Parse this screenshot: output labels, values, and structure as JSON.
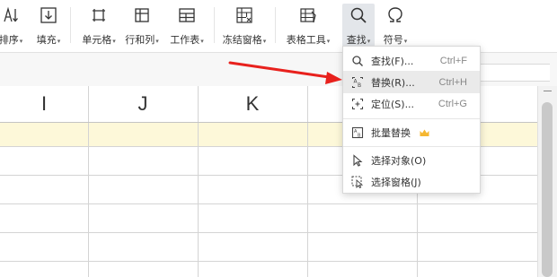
{
  "ribbon": {
    "sort_label": "排序",
    "fill_label": "填充",
    "cell_label": "单元格",
    "rowcol_label": "行和列",
    "worksheet_label": "工作表",
    "freeze_label": "冻结窗格",
    "tabletools_label": "表格工具",
    "find_label": "查找",
    "symbol_label": "符号",
    "caret": "▾"
  },
  "sheet": {
    "columns": [
      "I",
      "J",
      "K"
    ],
    "highlight_color": "#fdf8d9"
  },
  "find_menu": {
    "items": [
      {
        "label": "查找(F)...",
        "shortcut": "Ctrl+F",
        "icon": "search-icon"
      },
      {
        "label": "替换(R)...",
        "shortcut": "Ctrl+H",
        "icon": "replace-icon"
      },
      {
        "label": "定位(S)...",
        "shortcut": "Ctrl+G",
        "icon": "locate-icon"
      },
      {
        "label": "批量替换",
        "shortcut": "",
        "icon": "batch-replace-icon"
      },
      {
        "label": "选择对象(O)",
        "shortcut": "",
        "icon": "select-object-icon"
      },
      {
        "label": "选择窗格(J)",
        "shortcut": "",
        "icon": "select-pane-icon"
      }
    ]
  },
  "annotation": {
    "arrow_color": "#e8211d"
  },
  "colors": {
    "crown": "#f5b731"
  }
}
